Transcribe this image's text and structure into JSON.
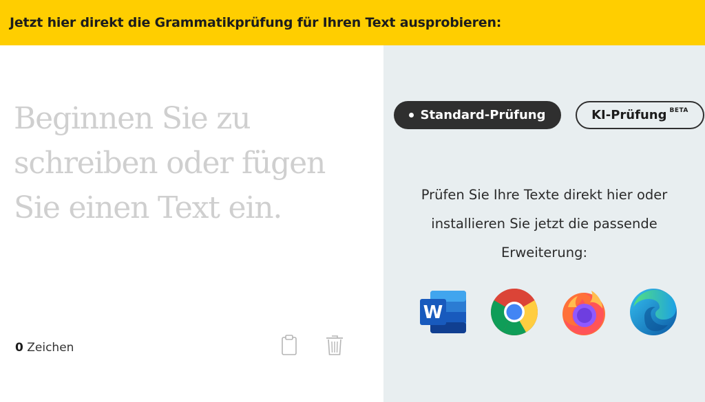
{
  "banner": {
    "text": "Jetzt hier direkt die Grammatikprüfung für Ihren Text ausprobieren:"
  },
  "editor": {
    "placeholder_lines": [
      "Beginnen Sie zu",
      "schreiben oder fügen",
      "Sie einen Text ein."
    ],
    "char_count": "0",
    "char_label": "Zeichen",
    "icons": [
      "clipboard-icon",
      "trash-icon"
    ]
  },
  "modes": {
    "standard_label": "Standard-Prüfung",
    "ki_label": "KI-Prüfung",
    "ki_badge": "BETA",
    "active": "standard"
  },
  "side": {
    "description": "Prüfen Sie Ihre Texte direkt hier oder installieren Sie jetzt die passende Erweiterung:"
  },
  "extensions": [
    {
      "name": "word-icon"
    },
    {
      "name": "chrome-icon"
    },
    {
      "name": "firefox-icon"
    },
    {
      "name": "edge-icon"
    }
  ],
  "colors": {
    "banner": "#ffce00",
    "side_panel": "#e8eef0",
    "active_button": "#2f2f2f",
    "placeholder": "#cfcfcf"
  }
}
